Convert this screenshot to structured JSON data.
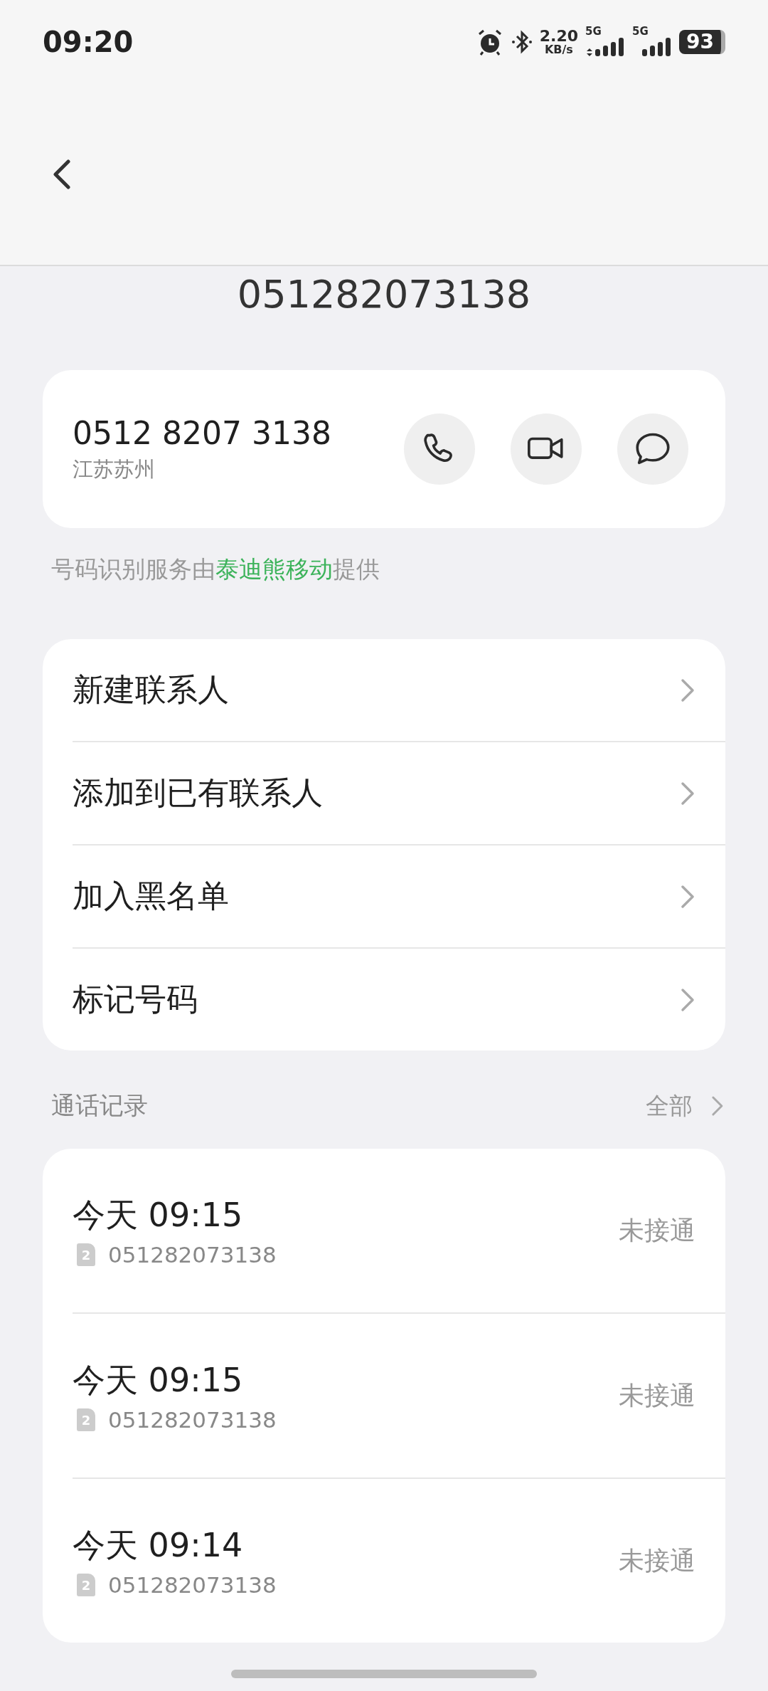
{
  "status_bar": {
    "time": "09:20",
    "net_speed": "2.20",
    "net_unit": "KB/s",
    "sim1_type": "5G",
    "sim2_type": "5G",
    "battery": "93"
  },
  "title": "051282073138",
  "contact_card": {
    "number": "0512 8207 3138",
    "location": "江苏苏州",
    "actions": [
      {
        "kind": "call"
      },
      {
        "kind": "video"
      },
      {
        "kind": "message"
      }
    ]
  },
  "attribution": {
    "prefix": "号码识别服务由",
    "provider": "泰迪熊移动",
    "suffix": "提供"
  },
  "menu": [
    {
      "label": "新建联系人"
    },
    {
      "label": "添加到已有联系人"
    },
    {
      "label": "加入黑名单"
    },
    {
      "label": "标记号码"
    }
  ],
  "call_log": {
    "title": "通话记录",
    "all_link": "全部",
    "entries": [
      {
        "time": "今天 09:15",
        "sim": "2",
        "number": "051282073138",
        "status": "未接通"
      },
      {
        "time": "今天 09:15",
        "sim": "2",
        "number": "051282073138",
        "status": "未接通"
      },
      {
        "time": "今天 09:14",
        "sim": "2",
        "number": "051282073138",
        "status": "未接通"
      }
    ]
  }
}
